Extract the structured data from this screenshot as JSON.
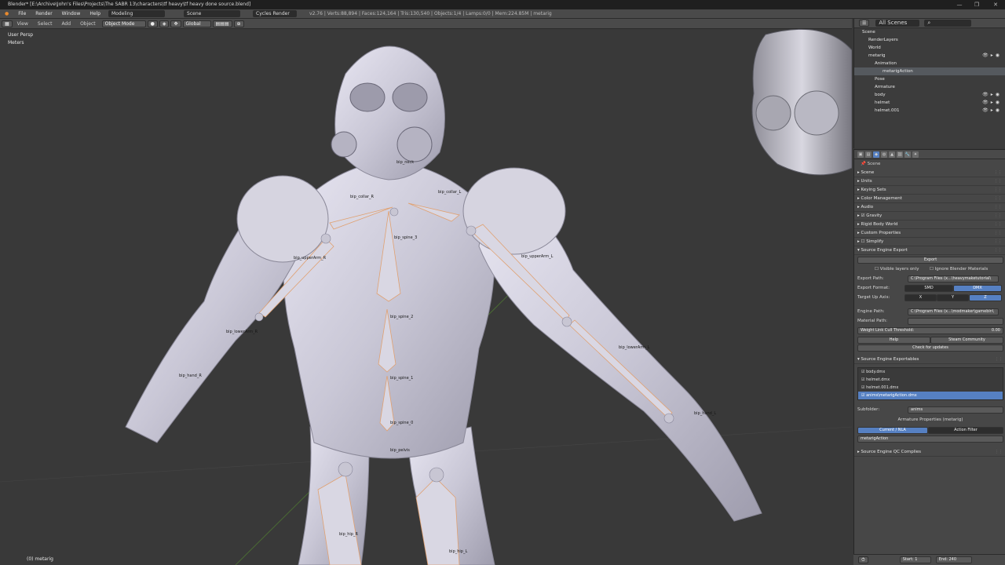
{
  "window": {
    "title": "Blender* [E:\\Archive\\John's Files\\Projects\\The SABR 13\\characters\\tf heavy\\tf heavy done source.blend]",
    "controls": [
      "—",
      "❐",
      "✕"
    ]
  },
  "info_header": {
    "menus": [
      "File",
      "Render",
      "Window",
      "Help"
    ],
    "layout": "Modeling",
    "scene": "Scene",
    "engine": "Cycles Render",
    "stats": "v2.76 | Verts:88,894 | Faces:124,164 | Tris:130,540 | Objects:1/4 | Lamps:0/0 | Mem:224.85M | metarig"
  },
  "viewport": {
    "view_name": "User Persp",
    "units": "Meters",
    "footer": "(0) metarig",
    "header_menus": [
      "View",
      "Select",
      "Add",
      "Object"
    ],
    "mode": "Object Mode",
    "orientation": "Global"
  },
  "bones": [
    "bip_neck",
    "bip_collar_R",
    "bip_collar_L",
    "bip_spine_3",
    "bip_upperArm_R",
    "bip_upperArm_L",
    "bip_spine_2",
    "bip_lowerArm_R",
    "bip_lowerArm_L",
    "bip_spine_1",
    "bip_hand_R",
    "bip_hand_L",
    "bip_spine_0",
    "bip_pelvis",
    "bip_hip_R",
    "bip_hip_L"
  ],
  "outliner": {
    "filter": "All Scenes",
    "rows": [
      {
        "label": "Scene",
        "indent": 0
      },
      {
        "label": "RenderLayers",
        "indent": 1
      },
      {
        "label": "World",
        "indent": 1
      },
      {
        "label": "metarig",
        "indent": 1
      },
      {
        "label": "Animation",
        "indent": 2
      },
      {
        "label": "metarigAction",
        "indent": 3
      },
      {
        "label": "Pose",
        "indent": 2
      },
      {
        "label": "Armature",
        "indent": 2
      },
      {
        "label": "body",
        "indent": 2
      },
      {
        "label": "helmet",
        "indent": 2
      },
      {
        "label": "helmet.001",
        "indent": 2
      }
    ]
  },
  "properties": {
    "breadcrumb": "Scene",
    "panels": [
      "Scene",
      "Units",
      "Keying Sets",
      "Color Management",
      "Audio",
      "Gravity",
      "Rigid Body World",
      "Custom Properties",
      "Simplify",
      "Source Engine Export"
    ],
    "export_button": "Export",
    "visible_layers_only": "Visible layers only",
    "ignore_materials": "Ignore Blender Materials",
    "export_path_label": "Export Path:",
    "export_path_value": "C:\\Program Files (x...\\heavymaketutorial\\",
    "export_format_label": "Export Format:",
    "format_smd": "SMD",
    "format_dmx": "DMX",
    "target_up_label": "Target Up Axis:",
    "axis_x": "X",
    "axis_y": "Y",
    "axis_z": "Z",
    "engine_path_label": "Engine Path:",
    "engine_path_value": "C:\\Program Files (x...\\modmaker\\gamebin\\",
    "material_path_label": "Material Path:",
    "weight_cull_label": "Weight Link Cull Threshold:",
    "weight_cull_value": "0.00",
    "help_button": "Help",
    "steam_button": "Steam Community",
    "check_updates": "Check for updates",
    "exportables_title": "Source Engine Exportables",
    "exportables": [
      "body.dmx",
      "helmet.dmx",
      "helmet.001.dmx",
      "anims\\metarigAction.dmx"
    ],
    "subfolder_label": "Subfolder:",
    "subfolder_value": "anims",
    "armature_props": "Armature Properties (metarig)",
    "current_nla": "Current / NLA",
    "action_filter": "Action Filter",
    "action_value": "metarigAction",
    "qc_title": "Source Engine QC Complies"
  },
  "timeline": {
    "start_label": "Start:",
    "start_value": "1",
    "end_label": "End:",
    "end_value": "240"
  }
}
